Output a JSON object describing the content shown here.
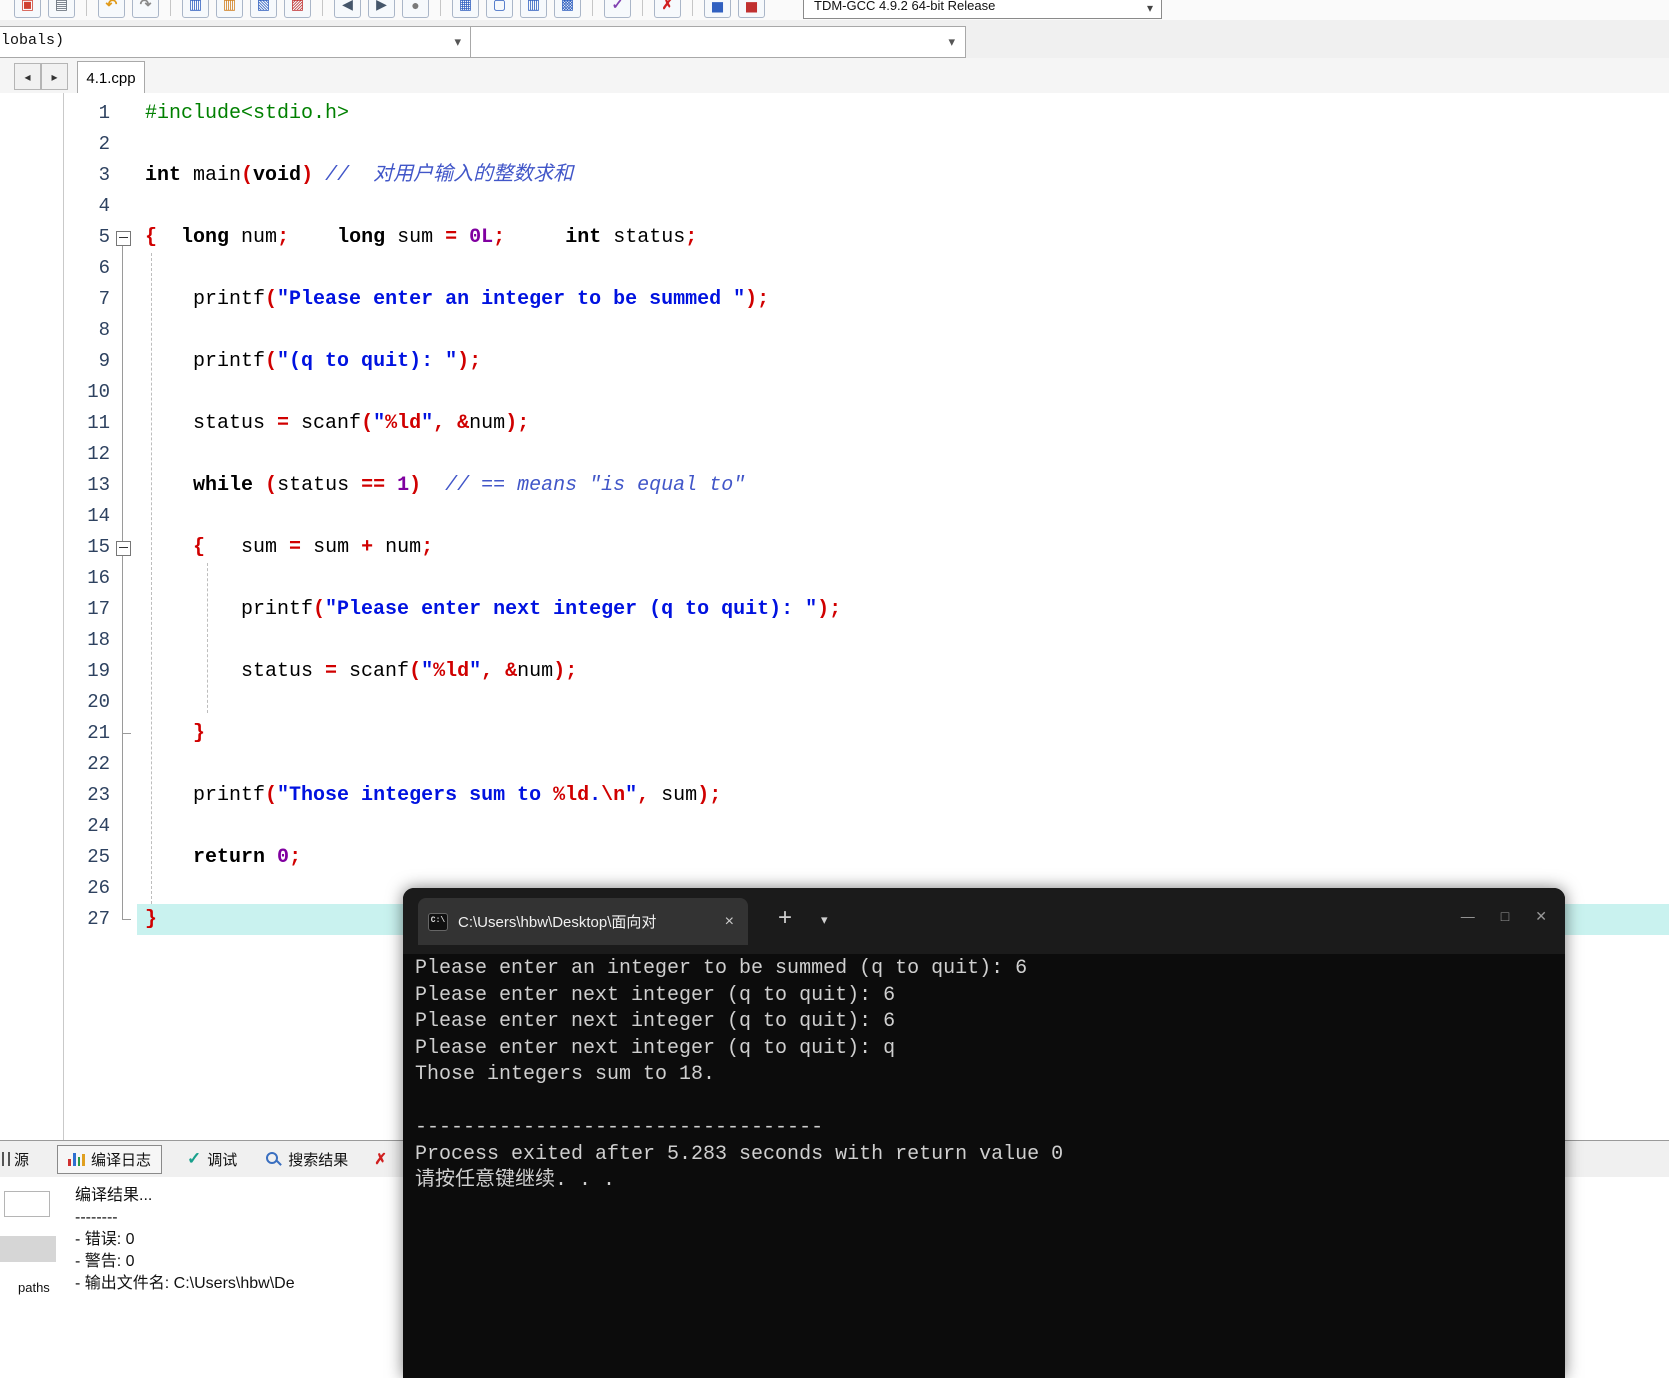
{
  "toolbar": {
    "compiler_profile": "TDM-GCC 4.9.2 64-bit Release",
    "groups": [
      [
        "open-icon",
        "print-icon"
      ],
      [
        "undo-icon",
        "redo-icon"
      ],
      [
        "find-icon",
        "replace-icon",
        "goto-icon",
        "bookmarks-icon"
      ],
      [
        "back-icon",
        "forward-icon",
        "record-icon"
      ],
      [
        "compile-icon",
        "run-icon",
        "compile-run-icon",
        "rebuild-icon"
      ],
      [
        "syntax-check-icon"
      ],
      [
        "abort-compile-icon"
      ],
      [
        "profile-icon",
        "profile-delete-icon"
      ]
    ]
  },
  "navbar": {
    "scope_combo": "lobals)",
    "member_combo": ""
  },
  "tabbar": {
    "active_tab": "4.1.cpp"
  },
  "editor": {
    "lines": [
      [
        [
          "pp",
          "#include<stdio.h>"
        ]
      ],
      [],
      [
        [
          "kw",
          "int"
        ],
        [
          "pl",
          " main"
        ],
        [
          "op",
          "("
        ],
        [
          "kw",
          "void"
        ],
        [
          "op",
          ")"
        ],
        [
          "cm",
          " //  对用户输入的整数求和"
        ]
      ],
      [],
      [
        [
          "br",
          "{"
        ],
        [
          "pl",
          "  "
        ],
        [
          "kw",
          "long"
        ],
        [
          "pl",
          " num"
        ],
        [
          "op",
          ";"
        ],
        [
          "pl",
          "    "
        ],
        [
          "kw",
          "long"
        ],
        [
          "pl",
          " sum "
        ],
        [
          "op",
          "="
        ],
        [
          "pl",
          " "
        ],
        [
          "nm",
          "0L"
        ],
        [
          "op",
          ";"
        ],
        [
          "pl",
          "     "
        ],
        [
          "kw",
          "int"
        ],
        [
          "pl",
          " status"
        ],
        [
          "op",
          ";"
        ]
      ],
      [],
      [
        [
          "pl",
          "    printf"
        ],
        [
          "op",
          "("
        ],
        [
          "st",
          "\"Please enter an integer to be summed \""
        ],
        [
          "op",
          ");"
        ]
      ],
      [],
      [
        [
          "pl",
          "    printf"
        ],
        [
          "op",
          "("
        ],
        [
          "st",
          "\"(q to quit): \""
        ],
        [
          "op",
          ");"
        ]
      ],
      [],
      [
        [
          "pl",
          "    status "
        ],
        [
          "op",
          "="
        ],
        [
          "pl",
          " scanf"
        ],
        [
          "op",
          "("
        ],
        [
          "st",
          "\""
        ],
        [
          "fm",
          "%ld"
        ],
        [
          "st",
          "\""
        ],
        [
          "op",
          ","
        ],
        [
          "pl",
          " "
        ],
        [
          "op",
          "&"
        ],
        [
          "pl",
          "num"
        ],
        [
          "op",
          ");"
        ]
      ],
      [],
      [
        [
          "pl",
          "    "
        ],
        [
          "kw",
          "while"
        ],
        [
          "pl",
          " "
        ],
        [
          "op",
          "("
        ],
        [
          "pl",
          "status "
        ],
        [
          "op",
          "=="
        ],
        [
          "pl",
          " "
        ],
        [
          "nm",
          "1"
        ],
        [
          "op",
          ")"
        ],
        [
          "cm",
          "  // == means \"is equal to\""
        ]
      ],
      [],
      [
        [
          "pl",
          "    "
        ],
        [
          "br",
          "{"
        ],
        [
          "pl",
          "   sum "
        ],
        [
          "op",
          "="
        ],
        [
          "pl",
          " sum "
        ],
        [
          "op",
          "+"
        ],
        [
          "pl",
          " num"
        ],
        [
          "op",
          ";"
        ]
      ],
      [],
      [
        [
          "pl",
          "        printf"
        ],
        [
          "op",
          "("
        ],
        [
          "st",
          "\"Please enter next integer (q to quit): \""
        ],
        [
          "op",
          ");"
        ]
      ],
      [],
      [
        [
          "pl",
          "        status "
        ],
        [
          "op",
          "="
        ],
        [
          "pl",
          " scanf"
        ],
        [
          "op",
          "("
        ],
        [
          "st",
          "\""
        ],
        [
          "fm",
          "%ld"
        ],
        [
          "st",
          "\""
        ],
        [
          "op",
          ","
        ],
        [
          "pl",
          " "
        ],
        [
          "op",
          "&"
        ],
        [
          "pl",
          "num"
        ],
        [
          "op",
          ");"
        ]
      ],
      [],
      [
        [
          "pl",
          "    "
        ],
        [
          "br",
          "}"
        ]
      ],
      [],
      [
        [
          "pl",
          "    printf"
        ],
        [
          "op",
          "("
        ],
        [
          "st",
          "\"Those integers sum to "
        ],
        [
          "fm",
          "%ld"
        ],
        [
          "st",
          "."
        ],
        [
          "fm",
          "\\n"
        ],
        [
          "st",
          "\""
        ],
        [
          "op",
          ","
        ],
        [
          "pl",
          " sum"
        ],
        [
          "op",
          ");"
        ]
      ],
      [],
      [
        [
          "pl",
          "    "
        ],
        [
          "kw",
          "return"
        ],
        [
          "pl",
          " "
        ],
        [
          "nm",
          "0"
        ],
        [
          "op",
          ";"
        ]
      ],
      [],
      [
        [
          "br",
          "}"
        ]
      ]
    ]
  },
  "terminal": {
    "title": "C:\\Users\\hbw\\Desktop\\面向对",
    "lines": [
      "Please enter an integer to be summed (q to quit): 6",
      "Please enter next integer (q to quit): 6",
      "Please enter next integer (q to quit): 6",
      "Please enter next integer (q to quit): q",
      "Those integers sum to 18.",
      "",
      "----------------------------------",
      "Process exited after 5.283 seconds with return value 0",
      "请按任意键继续. . ."
    ]
  },
  "bottom_panel": {
    "partial_tab": "源",
    "tabs": [
      {
        "label": "编译日志",
        "icon": "compile-log-icon"
      },
      {
        "label": "调试",
        "icon": "debug-check-icon"
      },
      {
        "label": "搜索结果",
        "icon": "search-results-icon"
      },
      {
        "label": "",
        "icon": "close-log-icon"
      }
    ],
    "log_lines": [
      "编译结果...",
      "--------",
      "- 错误: 0",
      "- 警告: 0",
      "- 输出文件名: C:\\Users\\hbw\\De"
    ],
    "side_label": "paths"
  }
}
